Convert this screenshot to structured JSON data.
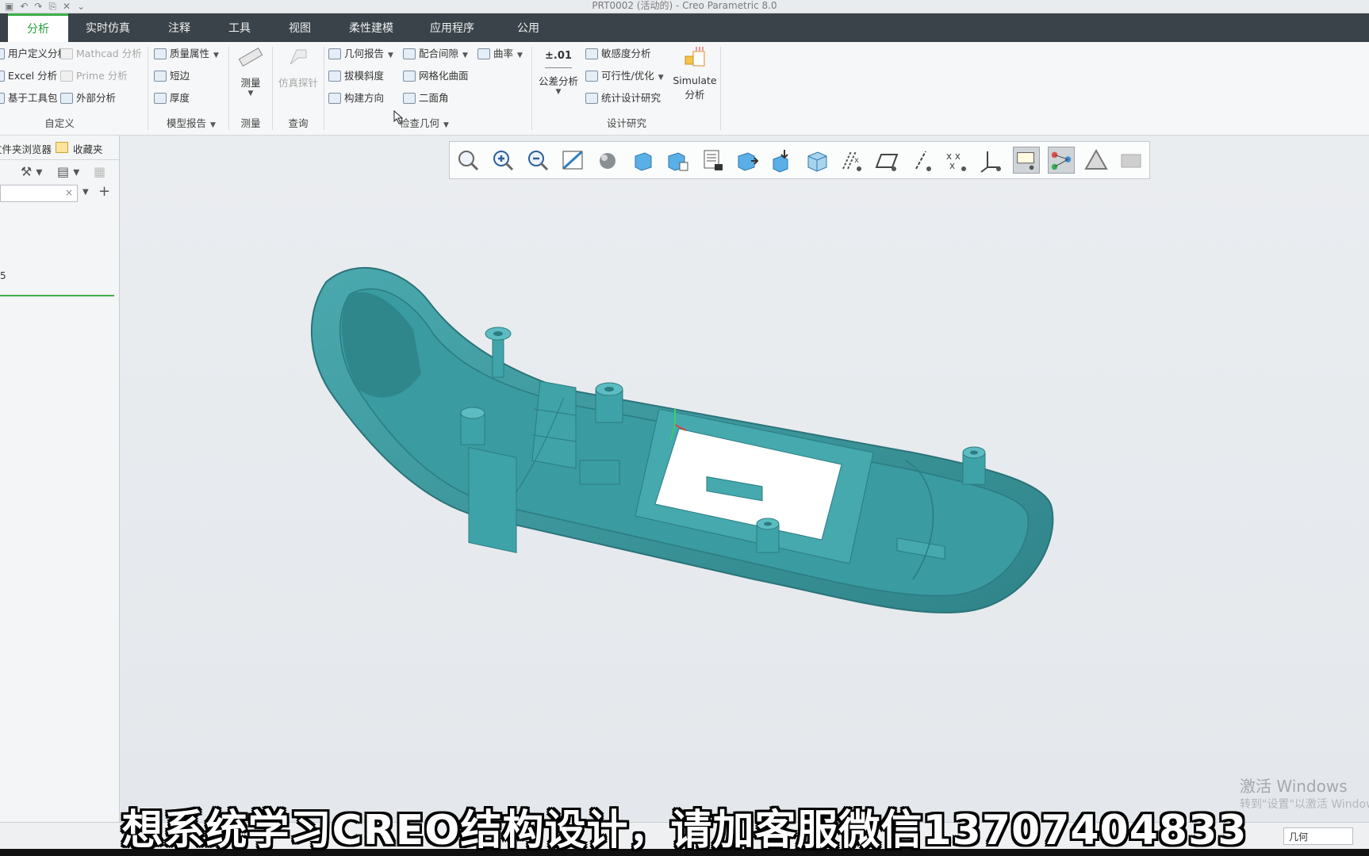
{
  "window": {
    "title": "PRT0002 (活动的) - Creo Parametric 8.0"
  },
  "tabs": [
    {
      "label": "分析",
      "active": true
    },
    {
      "label": "实时仿真"
    },
    {
      "label": "注释"
    },
    {
      "label": "工具"
    },
    {
      "label": "视图"
    },
    {
      "label": "柔性建模"
    },
    {
      "label": "应用程序"
    },
    {
      "label": "公用"
    }
  ],
  "ribbon": {
    "custom": {
      "user_analysis": "用户定义分析",
      "mathcad": "Mathcad 分析",
      "excel": "Excel 分析",
      "prime": "Prime 分析",
      "toolkit": "基于工具包",
      "external": "外部分析",
      "label": "自定义"
    },
    "model_report": {
      "mass": "质量属性",
      "short_edge": "短边",
      "thickness": "厚度",
      "label": "模型报告"
    },
    "measure": {
      "button": "测量",
      "label": "测量"
    },
    "query": {
      "button": "仿真探针",
      "label": "查询"
    },
    "inspect": {
      "geometry_report": "几何报告",
      "clearance": "配合间隙",
      "curvature": "曲率",
      "draft": "拔模斜度",
      "mesh_surface": "网格化曲面",
      "build_direction": "构建方向",
      "dihedral": "二面角",
      "label": "检查几何"
    },
    "design_study": {
      "tolerance_icon": "±.01",
      "tolerance": "公差分析",
      "sensitivity": "敏感度分析",
      "feasibility": "可行性/优化",
      "statistical": "统计设计研究",
      "simulate": "Simulate",
      "simulate2": "分析",
      "label": "设计研究"
    }
  },
  "left_panel": {
    "tab_browser": "文件夹浏览器",
    "tab_favorites": "收藏夹",
    "search_clear": "×",
    "add_symbol": "+",
    "item_fragment": "5"
  },
  "view_toolbar": {
    "icons": [
      "refit-icon",
      "zoom-in-icon",
      "zoom-out-icon",
      "repaint-icon",
      "display-style-icon",
      "saved-orientations-icon",
      "view-manager-icon",
      "perspective-icon",
      "section-icon",
      "spin-center-icon",
      "shaded-box-icon",
      "datum-display-icon",
      "plane-display-icon",
      "axis-display-icon",
      "point-display-icon",
      "csys-display-icon",
      "annotation-display-icon",
      "sketch-display-icon",
      "simulation-display-icon",
      "appearance-icon"
    ],
    "active": [
      15,
      16
    ]
  },
  "subtitle": "想系统学习CREO结构设计，请加客服微信13707404833",
  "watermark": {
    "line1": "激活 Windows",
    "line2": "转到\"设置\"以激活 Windows。"
  },
  "status": {
    "filter": "几何"
  },
  "colors": {
    "model": "#3b959a",
    "active_tab": "#3fae49",
    "tabbar": "#394349"
  }
}
